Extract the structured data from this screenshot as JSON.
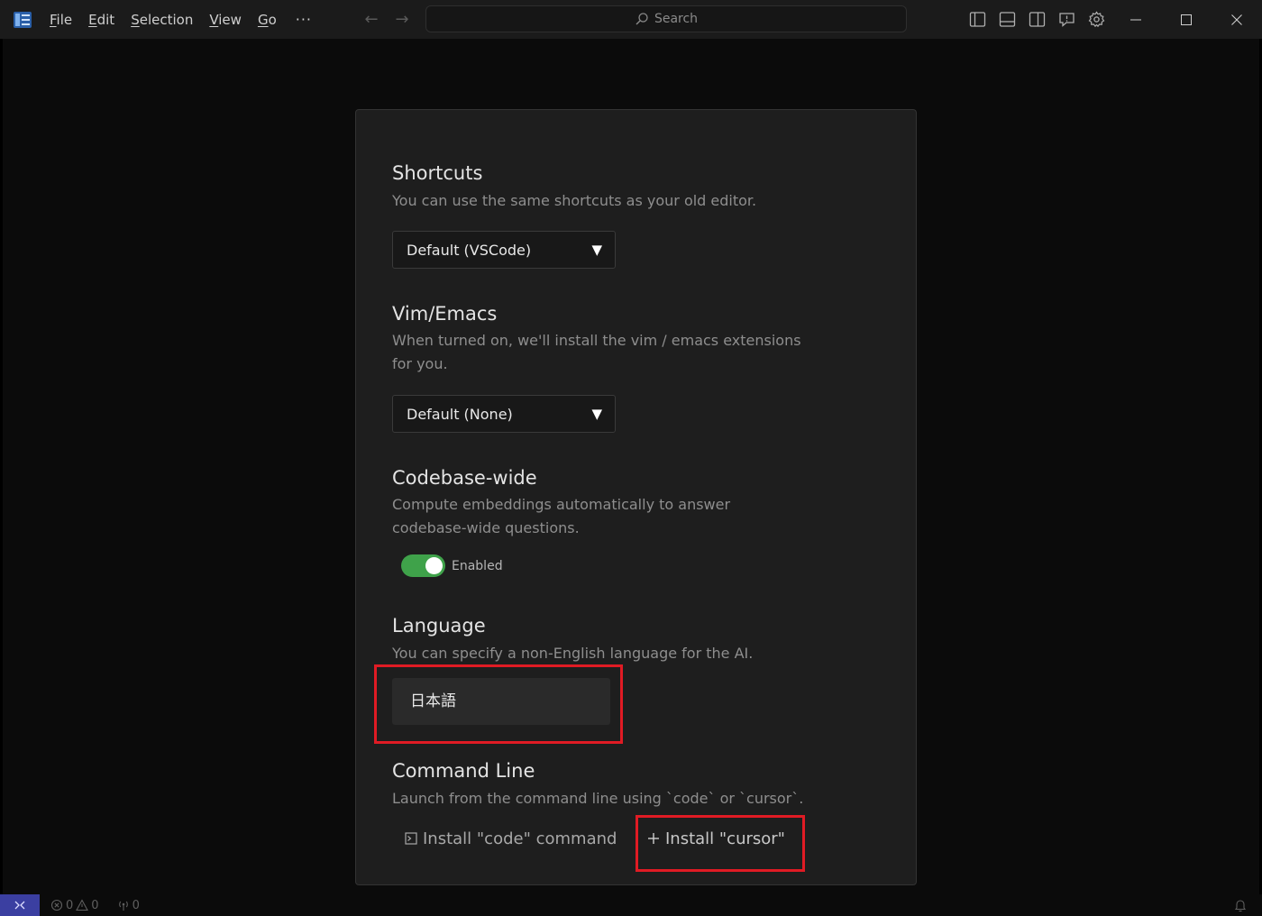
{
  "titlebar": {
    "menu": [
      {
        "label": "File",
        "mnemonic": "F"
      },
      {
        "label": "Edit",
        "mnemonic": "E"
      },
      {
        "label": "Selection",
        "mnemonic": "S"
      },
      {
        "label": "View",
        "mnemonic": "V"
      },
      {
        "label": "Go",
        "mnemonic": "G"
      }
    ],
    "more": "···",
    "search_label": "Search"
  },
  "settings": {
    "shortcuts": {
      "title": "Shortcuts",
      "description": "You can use the same shortcuts as your old editor.",
      "selected": "Default (VSCode)"
    },
    "vim_emacs": {
      "title": "Vim/Emacs",
      "description": "When turned on, we'll install the vim / emacs extensions for you.",
      "selected": "Default (None)"
    },
    "codebase": {
      "title": "Codebase-wide",
      "description": "Compute embeddings automatically to answer codebase-wide questions.",
      "toggle_label": "Enabled",
      "enabled": true
    },
    "language": {
      "title": "Language",
      "description": "You can specify a non-English language for the AI.",
      "value": "日本語"
    },
    "command_line": {
      "title": "Command Line",
      "description": "Launch from the command line using `code` or `cursor`.",
      "install_code": "Install \"code\" command",
      "install_cursor": "Install \"cursor\""
    }
  },
  "statusbar": {
    "errors": "0",
    "warnings": "0",
    "ports": "0"
  },
  "colors": {
    "highlight": "#e01b24",
    "toggle_on": "#3fa24a",
    "remote": "#3b3fa1"
  }
}
